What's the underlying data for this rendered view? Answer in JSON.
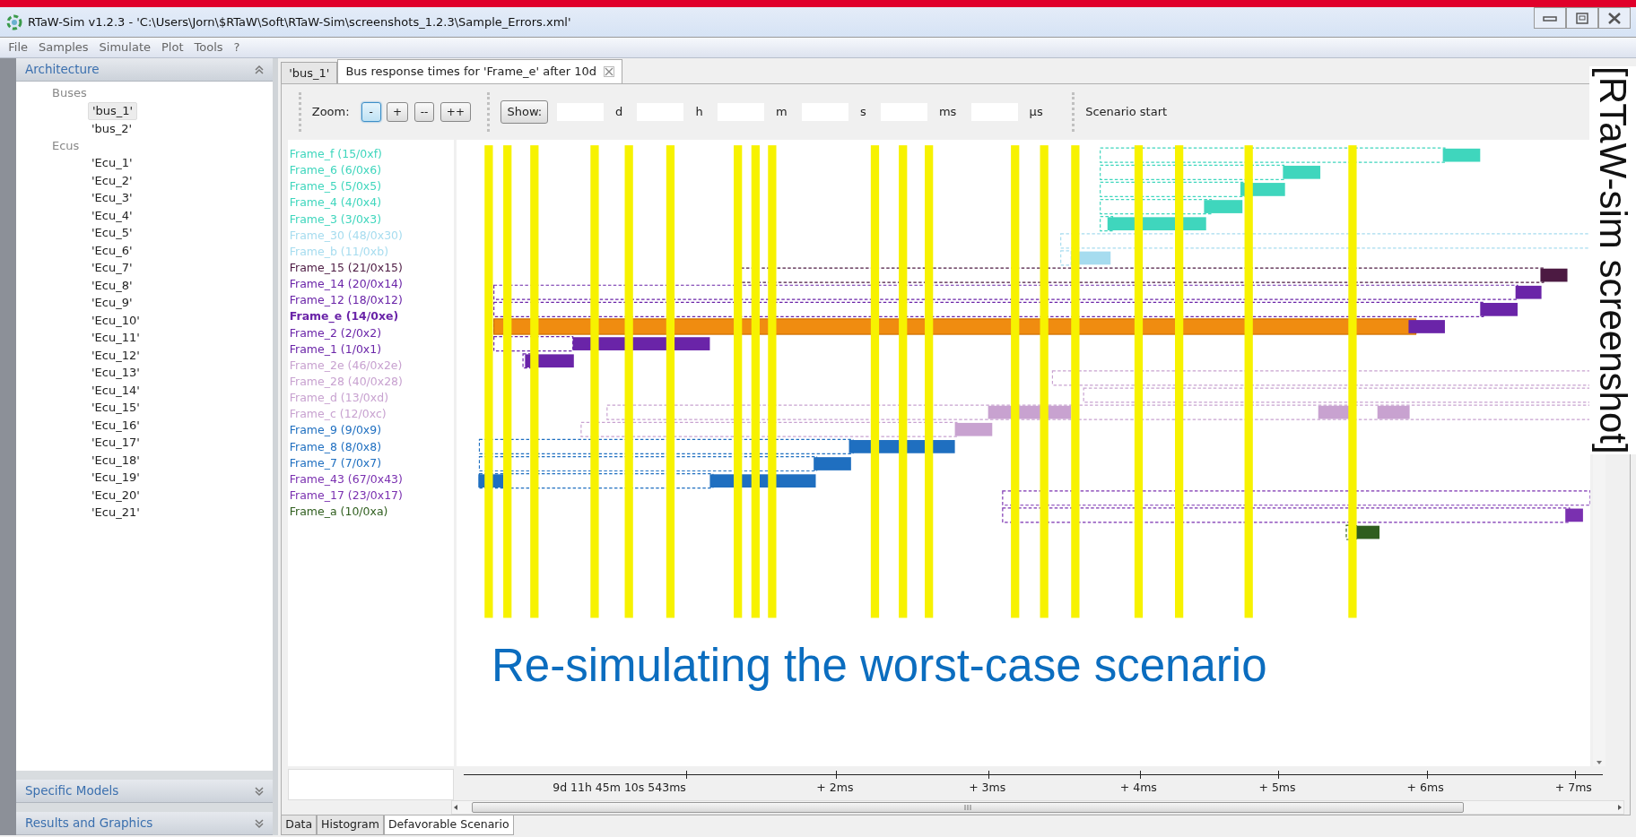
{
  "window": {
    "title": "RTaW-Sim v1.2.3 - 'C:\\Users\\Jorn\\$RTaW\\Soft\\RTaW-Sim\\screenshots_1.2.3\\Sample_Errors.xml'"
  },
  "menu": [
    "File",
    "Samples",
    "Simulate",
    "Plot",
    "Tools",
    "?"
  ],
  "sidebar": {
    "sections": [
      {
        "title": "Architecture",
        "expanded": true,
        "groups": [
          {
            "label": "Buses",
            "children": [
              {
                "label": "'bus_1'",
                "selected": true
              },
              {
                "label": "'bus_2'",
                "selected": false
              }
            ]
          },
          {
            "label": "Ecus",
            "children": [
              {
                "label": "'Ecu_1'",
                "selected": false
              },
              {
                "label": "'Ecu_2'",
                "selected": false
              },
              {
                "label": "'Ecu_3'",
                "selected": false
              },
              {
                "label": "'Ecu_4'",
                "selected": false
              },
              {
                "label": "'Ecu_5'",
                "selected": false
              },
              {
                "label": "'Ecu_6'",
                "selected": false
              },
              {
                "label": "'Ecu_7'",
                "selected": false
              },
              {
                "label": "'Ecu_8'",
                "selected": false
              },
              {
                "label": "'Ecu_9'",
                "selected": false
              },
              {
                "label": "'Ecu_10'",
                "selected": false
              },
              {
                "label": "'Ecu_11'",
                "selected": false
              },
              {
                "label": "'Ecu_12'",
                "selected": false
              },
              {
                "label": "'Ecu_13'",
                "selected": false
              },
              {
                "label": "'Ecu_14'",
                "selected": false
              },
              {
                "label": "'Ecu_15'",
                "selected": false
              },
              {
                "label": "'Ecu_16'",
                "selected": false
              },
              {
                "label": "'Ecu_17'",
                "selected": false
              },
              {
                "label": "'Ecu_18'",
                "selected": false
              },
              {
                "label": "'Ecu_19'",
                "selected": false
              },
              {
                "label": "'Ecu_20'",
                "selected": false
              },
              {
                "label": "'Ecu_21'",
                "selected": false
              }
            ]
          }
        ]
      },
      {
        "title": "Specific Models",
        "expanded": false
      },
      {
        "title": "Results and Graphics",
        "expanded": false
      }
    ]
  },
  "tabs": [
    {
      "label": "'bus_1'",
      "selected": false,
      "closable": false
    },
    {
      "label": "Bus response times for 'Frame_e' after 10d",
      "selected": true,
      "closable": true
    }
  ],
  "toolbar": {
    "zoom_label": "Zoom:",
    "zoom_buttons": [
      {
        "label": "-",
        "focused": true
      },
      {
        "label": "+",
        "focused": false
      },
      {
        "label": "--",
        "focused": false
      },
      {
        "label": "++",
        "focused": false
      }
    ],
    "show_button": "Show:",
    "time_units": [
      "d",
      "h",
      "m",
      "s",
      "ms",
      "µs"
    ],
    "position_label": "Scenario start"
  },
  "frames": [
    {
      "label": "Frame_f (15/0xf)",
      "color": "#3fd6bd",
      "selected": false
    },
    {
      "label": "Frame_6 (6/0x6)",
      "color": "#3fd6bd",
      "selected": false
    },
    {
      "label": "Frame_5 (5/0x5)",
      "color": "#3fd6bd",
      "selected": false
    },
    {
      "label": "Frame_4 (4/0x4)",
      "color": "#3fd6bd",
      "selected": false
    },
    {
      "label": "Frame_3 (3/0x3)",
      "color": "#3fd6bd",
      "selected": false
    },
    {
      "label": "Frame_30 (48/0x30)",
      "color": "#a6dcef",
      "selected": false
    },
    {
      "label": "Frame_b (11/0xb)",
      "color": "#a6dcef",
      "selected": false
    },
    {
      "label": "Frame_15 (21/0x15)",
      "color": "#4c1a42",
      "selected": false
    },
    {
      "label": "Frame_14 (20/0x14)",
      "color": "#6a24a8",
      "selected": false
    },
    {
      "label": "Frame_12 (18/0x12)",
      "color": "#6a24a8",
      "selected": false
    },
    {
      "label": "Frame_e (14/0xe)",
      "color": "#6a24a8",
      "selected": true
    },
    {
      "label": "Frame_2 (2/0x2)",
      "color": "#6a24a8",
      "selected": false
    },
    {
      "label": "Frame_1 (1/0x1)",
      "color": "#6a24a8",
      "selected": false
    },
    {
      "label": "Frame_2e (46/0x2e)",
      "color": "#c8a2d0",
      "selected": false
    },
    {
      "label": "Frame_28 (40/0x28)",
      "color": "#c8a2d0",
      "selected": false
    },
    {
      "label": "Frame_d (13/0xd)",
      "color": "#c8a2d0",
      "selected": false
    },
    {
      "label": "Frame_c (12/0xc)",
      "color": "#c8a2d0",
      "selected": false
    },
    {
      "label": "Frame_9 (9/0x9)",
      "color": "#1f6fc0",
      "selected": false
    },
    {
      "label": "Frame_8 (8/0x8)",
      "color": "#1f6fc0",
      "selected": false
    },
    {
      "label": "Frame_7 (7/0x7)",
      "color": "#1f6fc0",
      "selected": false
    },
    {
      "label": "Frame_43 (67/0x43)",
      "color": "#7a30b0",
      "selected": false
    },
    {
      "label": "Frame_17 (23/0x17)",
      "color": "#7a30b0",
      "selected": false
    },
    {
      "label": "Frame_a (10/0xa)",
      "color": "#2f5e1e",
      "selected": false
    }
  ],
  "axis": {
    "ticks": [
      "9d 11h 45m 10s 543ms",
      "+ 2ms",
      "+ 3ms",
      "+ 4ms",
      "+ 5ms",
      "+ 6ms",
      "+ 7ms"
    ]
  },
  "bottom_tabs": [
    {
      "label": "Data",
      "selected": false
    },
    {
      "label": "Histogram",
      "selected": false
    },
    {
      "label": "Defavorable Scenario",
      "selected": true
    }
  ],
  "overlay": {
    "caption": "Re-simulating the worst-case scenario",
    "side_label": "[RTaW-sim screenshot]"
  }
}
